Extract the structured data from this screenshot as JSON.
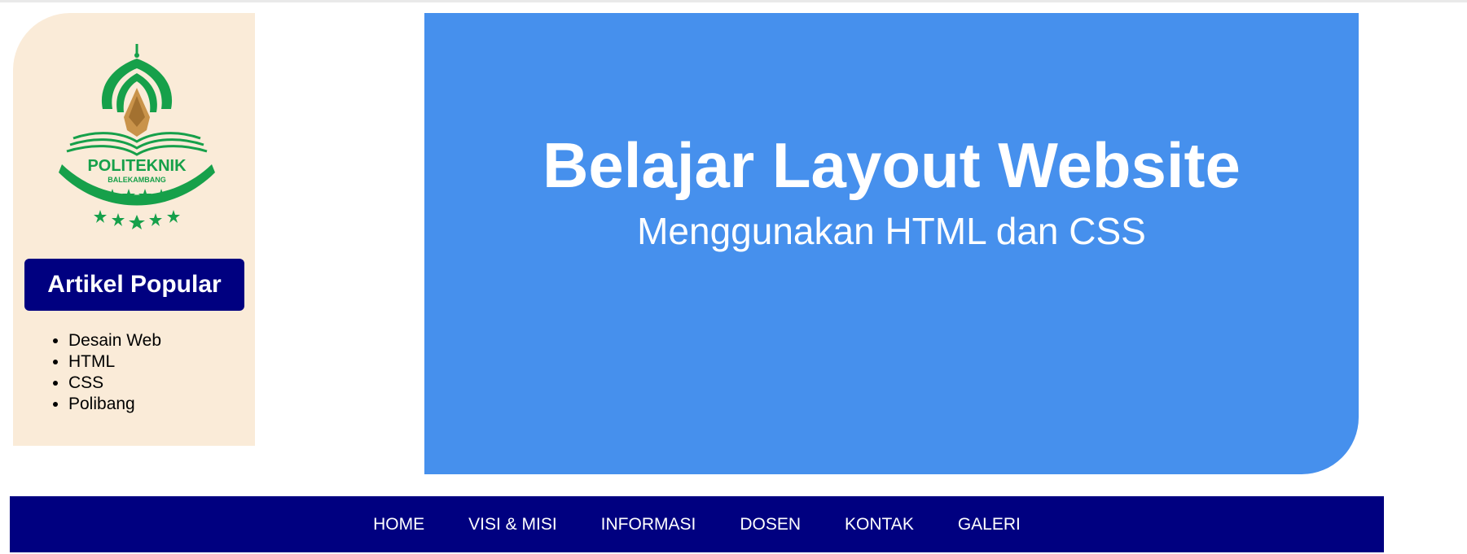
{
  "sidebar": {
    "logo": {
      "icon": "politeknik-balekambang-logo",
      "line1": "POLITEKNIK",
      "line2": "BALEKAMBANG"
    },
    "heading": "Artikel Popular",
    "items": [
      {
        "label": "Desain Web"
      },
      {
        "label": "HTML"
      },
      {
        "label": "CSS"
      },
      {
        "label": "Polibang"
      }
    ]
  },
  "hero": {
    "title": "Belajar Layout Website",
    "subtitle": "Menggunakan HTML dan CSS"
  },
  "nav": {
    "items": [
      {
        "label": "HOME"
      },
      {
        "label": "VISI & MISI"
      },
      {
        "label": "INFORMASI"
      },
      {
        "label": "DOSEN"
      },
      {
        "label": "KONTAK"
      },
      {
        "label": "GALERI"
      }
    ]
  },
  "colors": {
    "sidebar_bg": "#faebd8",
    "heading_bg": "#000080",
    "hero_bg": "#4690ed",
    "nav_bg": "#000080",
    "logo_green": "#16a04a",
    "logo_gold": "#c9934a"
  }
}
